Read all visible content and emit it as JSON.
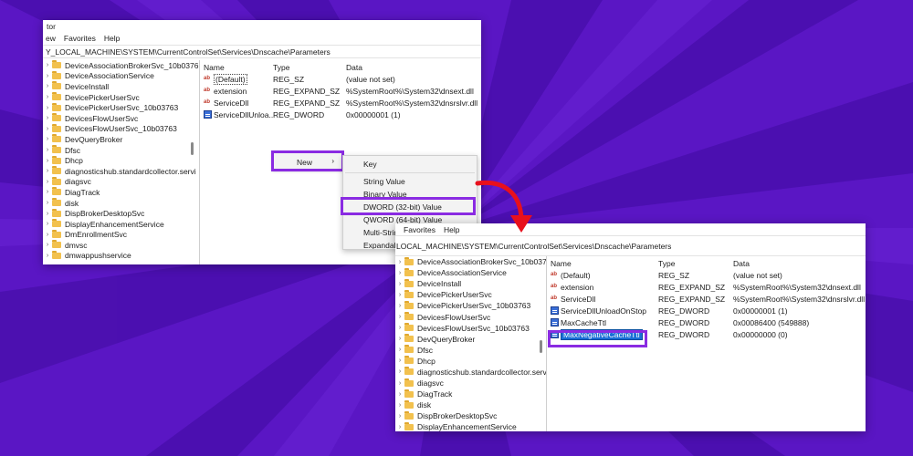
{
  "colors": {
    "background": "#5a16c4",
    "highlight": "#8a2be2",
    "arrow": "#e8101c",
    "edit_selection": "#1a6fd6"
  },
  "window1": {
    "title": "tor",
    "menu": [
      "ew",
      "Favorites",
      "Help"
    ],
    "address": "Y_LOCAL_MACHINE\\SYSTEM\\CurrentControlSet\\Services\\Dnscache\\Parameters",
    "tree": [
      "DeviceAssociationBrokerSvc_10b0376:",
      "DeviceAssociationService",
      "DeviceInstall",
      "DevicePickerUserSvc",
      "DevicePickerUserSvc_10b03763",
      "DevicesFlowUserSvc",
      "DevicesFlowUserSvc_10b03763",
      "DevQueryBroker",
      "Dfsc",
      "Dhcp",
      "diagnosticshub.standardcollector.servi",
      "diagsvc",
      "DiagTrack",
      "disk",
      "DispBrokerDesktopSvc",
      "DisplayEnhancementService",
      "DmEnrollmentSvc",
      "dmvsc",
      "dmwappushservice"
    ],
    "columns": {
      "name": "Name",
      "type": "Type",
      "data": "Data"
    },
    "values": [
      {
        "name": "(Default)",
        "type": "REG_SZ",
        "data": "(value not set)",
        "icon": "string-value-icon"
      },
      {
        "name": "extension",
        "type": "REG_EXPAND_SZ",
        "data": "%SystemRoot%\\System32\\dnsext.dll",
        "icon": "string-value-icon"
      },
      {
        "name": "ServiceDll",
        "type": "REG_EXPAND_SZ",
        "data": "%SystemRoot%\\System32\\dnsrslvr.dll",
        "icon": "string-value-icon"
      },
      {
        "name": "ServiceDllUnloa...",
        "type": "REG_DWORD",
        "data": "0x00000001 (1)",
        "icon": "dword-value-icon"
      }
    ],
    "context_menu": {
      "new_label": "New",
      "new_arrow": "›",
      "submenu": [
        "Key",
        "String Value",
        "Binary Value",
        "DWORD (32-bit) Value",
        "QWORD (64-bit) Value",
        "Multi-Strin",
        "Expandab"
      ]
    }
  },
  "window2": {
    "menu": [
      "Favorites",
      "Help"
    ],
    "address": "LOCAL_MACHINE\\SYSTEM\\CurrentControlSet\\Services\\Dnscache\\Parameters",
    "tree": [
      "DeviceAssociationBrokerSvc_10b0376:",
      "DeviceAssociationService",
      "DeviceInstall",
      "DevicePickerUserSvc",
      "DevicePickerUserSvc_10b03763",
      "DevicesFlowUserSvc",
      "DevicesFlowUserSvc_10b03763",
      "DevQueryBroker",
      "Dfsc",
      "Dhcp",
      "diagnosticshub.standardcollector.servi",
      "diagsvc",
      "DiagTrack",
      "disk",
      "DispBrokerDesktopSvc",
      "DisplayEnhancementService"
    ],
    "columns": {
      "name": "Name",
      "type": "Type",
      "data": "Data"
    },
    "values": [
      {
        "name": "(Default)",
        "type": "REG_SZ",
        "data": "(value not set)",
        "icon": "string-value-icon"
      },
      {
        "name": "extension",
        "type": "REG_EXPAND_SZ",
        "data": "%SystemRoot%\\System32\\dnsext.dll",
        "icon": "string-value-icon"
      },
      {
        "name": "ServiceDll",
        "type": "REG_EXPAND_SZ",
        "data": "%SystemRoot%\\System32\\dnsrslvr.dll",
        "icon": "string-value-icon"
      },
      {
        "name": "ServiceDllUnloadOnStop",
        "type": "REG_DWORD",
        "data": "0x00000001 (1)",
        "icon": "dword-value-icon"
      },
      {
        "name": "MaxCacheTtl",
        "type": "REG_DWORD",
        "data": "0x00086400 (549888)",
        "icon": "dword-value-icon"
      },
      {
        "name": "MaxNegativeCacheTtl",
        "type": "REG_DWORD",
        "data": "0x00000000 (0)",
        "icon": "dword-value-icon"
      }
    ]
  }
}
